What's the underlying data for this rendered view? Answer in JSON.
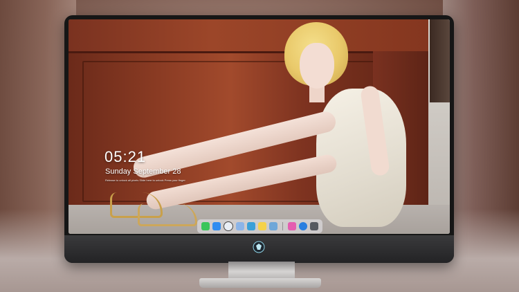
{
  "lock_screen": {
    "time": "05:21",
    "date": "Sunday September  28",
    "hint": "Release to unlock all pixels  Slide here to unlock  Press your finger"
  },
  "dock": {
    "items": [
      {
        "name": "messages-icon",
        "color": "#3bc55b"
      },
      {
        "name": "finder-icon",
        "color": "#2f8cf0"
      },
      {
        "name": "safari-icon",
        "color": "#e9eef5"
      },
      {
        "name": "photos-icon",
        "color": "#8bb4e8"
      },
      {
        "name": "video-icon",
        "color": "#3aa0d8"
      },
      {
        "name": "notes-icon",
        "color": "#f5d24b"
      },
      {
        "name": "preview-icon",
        "color": "#6fa7d8"
      },
      {
        "name": "itunes-icon",
        "color": "#e45db0"
      },
      {
        "name": "appstore-icon",
        "color": "#2a7fe0"
      },
      {
        "name": "display-icon",
        "color": "#565a60"
      }
    ]
  },
  "colors": {
    "bezel": "#161616",
    "dock_bg": "rgba(235,235,240,.55)"
  }
}
